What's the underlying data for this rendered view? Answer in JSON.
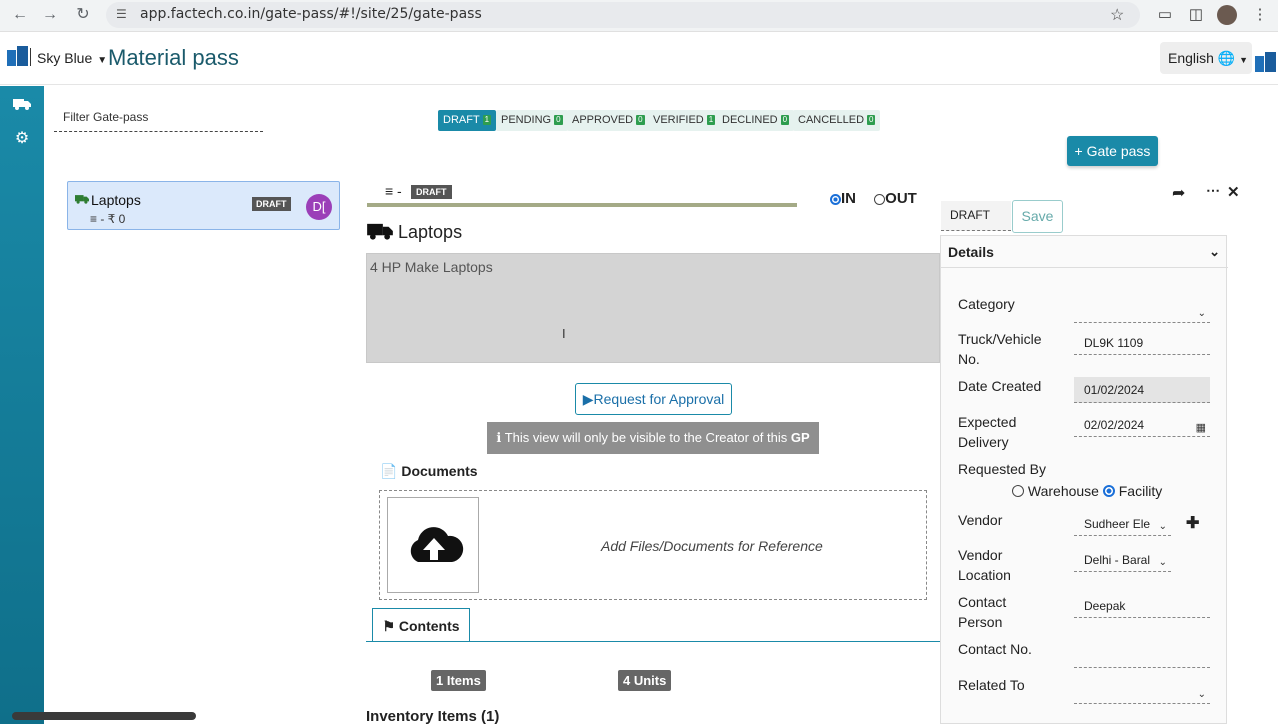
{
  "browser": {
    "url": "app.factech.co.in/gate-pass/#!/site/25/gate-pass"
  },
  "header": {
    "brand": "Sky Blue",
    "title": "Material pass",
    "language": "English"
  },
  "filter": {
    "placeholder": "Filter Gate-pass"
  },
  "status_tabs": [
    {
      "label": "DRAFT",
      "count": "1"
    },
    {
      "label": "PENDING",
      "count": "0"
    },
    {
      "label": "APPROVED",
      "count": "0"
    },
    {
      "label": "VERIFIED",
      "count": "1"
    },
    {
      "label": "DECLINED",
      "count": "0"
    },
    {
      "label": "CANCELLED",
      "count": "0"
    }
  ],
  "new_gate_pass_label": "+ Gate pass",
  "list": {
    "item": {
      "name": "Laptops",
      "sub": "≡ - ₹ 0",
      "status": "DRAFT",
      "avatar": "D["
    }
  },
  "detail": {
    "status": "DRAFT",
    "in_label": "IN",
    "out_label": "OUT",
    "title": "Laptops",
    "description": "4 HP Make Laptops",
    "request_label": "Request for Approval",
    "info_text": "This view will only be visible to the Creator of this",
    "info_bold": "GP",
    "documents_label": "Documents",
    "documents_placeholder": "Add Files/Documents for Reference",
    "contents_tab": "Contents",
    "items_count": "1 Items",
    "units_count": "4 Units",
    "inventory_title": "Inventory Items (1)"
  },
  "panel": {
    "status": "DRAFT",
    "save_label": "Save",
    "section": "Details",
    "category_label": "Category",
    "category_value": "",
    "vehicle_label_1": "Truck/Vehicle",
    "vehicle_label_2": "No.",
    "vehicle_value": "DL9K 1109",
    "date_created_label": "Date Created",
    "date_created_value": "01/02/2024",
    "expected_label_1": "Expected",
    "expected_label_2": "Delivery",
    "expected_value": "02/02/2024",
    "requested_by_label": "Requested By",
    "warehouse_label": "Warehouse",
    "facility_label": "Facility",
    "vendor_label": "Vendor",
    "vendor_value": "Sudheer Ele",
    "vendor_location_label_1": "Vendor",
    "vendor_location_label_2": "Location",
    "vendor_location_value": "Delhi - Baral",
    "contact_person_label_1": "Contact",
    "contact_person_label_2": "Person",
    "contact_person_value": "Deepak",
    "contact_no_label": "Contact No.",
    "contact_no_value": "",
    "related_to_label": "Related To",
    "related_to_value": ""
  },
  "colors": {
    "accent": "#1a8aa8",
    "title": "#1a5a6b",
    "count_badge": "#2e9d4f",
    "avatar": "#9b3fb8"
  }
}
